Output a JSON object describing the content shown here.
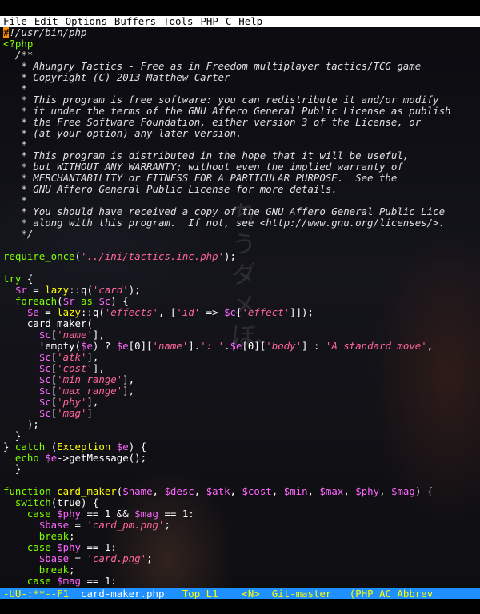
{
  "menu": [
    "File",
    "Edit",
    "Options",
    "Buffers",
    "Tools",
    "PHP",
    "C",
    "Help"
  ],
  "background_glyphs": "ちうダメぼ、",
  "code_lines": [
    [
      {
        "t": "#",
        "c": "cursor"
      },
      {
        "t": "!/usr/bin/php",
        "c": "cm"
      }
    ],
    [
      {
        "t": "<?php",
        "c": "kw"
      }
    ],
    [
      {
        "t": "  /**",
        "c": "cm"
      }
    ],
    [
      {
        "t": "   * Ahungry Tactics - Free as in Freedom multiplayer tactics/TCG game",
        "c": "cm"
      }
    ],
    [
      {
        "t": "   * Copyright (C) 2013 Matthew Carter",
        "c": "cm"
      }
    ],
    [
      {
        "t": "   *",
        "c": "cm"
      }
    ],
    [
      {
        "t": "   * This program is free software: you can redistribute it and/or modify",
        "c": "cm"
      }
    ],
    [
      {
        "t": "   * it under the terms of the GNU Affero General Public License as publish",
        "c": "cm"
      }
    ],
    [
      {
        "t": "   * the Free Software Foundation, either version 3 of the License, or",
        "c": "cm"
      }
    ],
    [
      {
        "t": "   * (at your option) any later version.",
        "c": "cm"
      }
    ],
    [
      {
        "t": "   *",
        "c": "cm"
      }
    ],
    [
      {
        "t": "   * This program is distributed in the hope that it will be useful,",
        "c": "cm"
      }
    ],
    [
      {
        "t": "   * but WITHOUT ANY WARRANTY; without even the implied warranty of",
        "c": "cm"
      }
    ],
    [
      {
        "t": "   * MERCHANTABILITY or FITNESS FOR A PARTICULAR PURPOSE.  See the",
        "c": "cm"
      }
    ],
    [
      {
        "t": "   * GNU Affero General Public License for more details.",
        "c": "cm"
      }
    ],
    [
      {
        "t": "   *",
        "c": "cm"
      }
    ],
    [
      {
        "t": "   * You should have received a copy of the GNU Affero General Public Lice",
        "c": "cm"
      }
    ],
    [
      {
        "t": "   * along with this program.  If not, see <http://www.gnu.org/licenses/>.",
        "c": "cm"
      }
    ],
    [
      {
        "t": "   */",
        "c": "cm"
      }
    ],
    [
      {
        "t": "",
        "c": ""
      }
    ],
    [
      {
        "t": "require_once",
        "c": "kw"
      },
      {
        "t": "(",
        "c": ""
      },
      {
        "t": "'../ini/tactics.inc.php'",
        "c": "str"
      },
      {
        "t": ");",
        "c": ""
      }
    ],
    [
      {
        "t": "",
        "c": ""
      }
    ],
    [
      {
        "t": "try",
        "c": "kw"
      },
      {
        "t": " {",
        "c": ""
      }
    ],
    [
      {
        "t": "  ",
        "c": ""
      },
      {
        "t": "$r",
        "c": "var"
      },
      {
        "t": " = ",
        "c": ""
      },
      {
        "t": "lazy",
        "c": "fn"
      },
      {
        "t": "::q(",
        "c": ""
      },
      {
        "t": "'card'",
        "c": "str"
      },
      {
        "t": ");",
        "c": ""
      }
    ],
    [
      {
        "t": "  ",
        "c": ""
      },
      {
        "t": "foreach",
        "c": "kw"
      },
      {
        "t": "(",
        "c": ""
      },
      {
        "t": "$r",
        "c": "var"
      },
      {
        "t": " as ",
        "c": "kw"
      },
      {
        "t": "$c",
        "c": "var"
      },
      {
        "t": ") {",
        "c": ""
      }
    ],
    [
      {
        "t": "    ",
        "c": ""
      },
      {
        "t": "$e",
        "c": "var"
      },
      {
        "t": " = ",
        "c": ""
      },
      {
        "t": "lazy",
        "c": "fn"
      },
      {
        "t": "::q(",
        "c": ""
      },
      {
        "t": "'effects'",
        "c": "str"
      },
      {
        "t": ", [",
        "c": ""
      },
      {
        "t": "'id'",
        "c": "str"
      },
      {
        "t": " => ",
        "c": ""
      },
      {
        "t": "$c",
        "c": "var"
      },
      {
        "t": "[",
        "c": ""
      },
      {
        "t": "'effect'",
        "c": "str"
      },
      {
        "t": "]]);",
        "c": ""
      }
    ],
    [
      {
        "t": "    card_maker(",
        "c": ""
      }
    ],
    [
      {
        "t": "      ",
        "c": ""
      },
      {
        "t": "$c",
        "c": "var"
      },
      {
        "t": "[",
        "c": ""
      },
      {
        "t": "'name'",
        "c": "str"
      },
      {
        "t": "],",
        "c": ""
      }
    ],
    [
      {
        "t": "      !empty(",
        "c": ""
      },
      {
        "t": "$e",
        "c": "var"
      },
      {
        "t": ") ? ",
        "c": ""
      },
      {
        "t": "$e",
        "c": "var"
      },
      {
        "t": "[0][",
        "c": ""
      },
      {
        "t": "'name'",
        "c": "str"
      },
      {
        "t": "].",
        "c": ""
      },
      {
        "t": "': '",
        "c": "str"
      },
      {
        "t": ".",
        "c": ""
      },
      {
        "t": "$e",
        "c": "var"
      },
      {
        "t": "[0][",
        "c": ""
      },
      {
        "t": "'body'",
        "c": "str"
      },
      {
        "t": "] : ",
        "c": ""
      },
      {
        "t": "'A standard move'",
        "c": "str"
      },
      {
        "t": ",",
        "c": ""
      }
    ],
    [
      {
        "t": "      ",
        "c": ""
      },
      {
        "t": "$c",
        "c": "var"
      },
      {
        "t": "[",
        "c": ""
      },
      {
        "t": "'atk'",
        "c": "str"
      },
      {
        "t": "],",
        "c": ""
      }
    ],
    [
      {
        "t": "      ",
        "c": ""
      },
      {
        "t": "$c",
        "c": "var"
      },
      {
        "t": "[",
        "c": ""
      },
      {
        "t": "'cost'",
        "c": "str"
      },
      {
        "t": "],",
        "c": ""
      }
    ],
    [
      {
        "t": "      ",
        "c": ""
      },
      {
        "t": "$c",
        "c": "var"
      },
      {
        "t": "[",
        "c": ""
      },
      {
        "t": "'min range'",
        "c": "str"
      },
      {
        "t": "],",
        "c": ""
      }
    ],
    [
      {
        "t": "      ",
        "c": ""
      },
      {
        "t": "$c",
        "c": "var"
      },
      {
        "t": "[",
        "c": ""
      },
      {
        "t": "'max range'",
        "c": "str"
      },
      {
        "t": "],",
        "c": ""
      }
    ],
    [
      {
        "t": "      ",
        "c": ""
      },
      {
        "t": "$c",
        "c": "var"
      },
      {
        "t": "[",
        "c": ""
      },
      {
        "t": "'phy'",
        "c": "str"
      },
      {
        "t": "],",
        "c": ""
      }
    ],
    [
      {
        "t": "      ",
        "c": ""
      },
      {
        "t": "$c",
        "c": "var"
      },
      {
        "t": "[",
        "c": ""
      },
      {
        "t": "'mag'",
        "c": "str"
      },
      {
        "t": "]",
        "c": ""
      }
    ],
    [
      {
        "t": "    );",
        "c": ""
      }
    ],
    [
      {
        "t": "  }",
        "c": ""
      }
    ],
    [
      {
        "t": "} ",
        "c": ""
      },
      {
        "t": "catch",
        "c": "kw"
      },
      {
        "t": " (",
        "c": ""
      },
      {
        "t": "Exception",
        "c": "fn"
      },
      {
        "t": " ",
        "c": ""
      },
      {
        "t": "$e",
        "c": "var"
      },
      {
        "t": ") {",
        "c": ""
      }
    ],
    [
      {
        "t": "  ",
        "c": ""
      },
      {
        "t": "echo",
        "c": "kw"
      },
      {
        "t": " ",
        "c": ""
      },
      {
        "t": "$e",
        "c": "var"
      },
      {
        "t": "->getMessage();",
        "c": ""
      }
    ],
    [
      {
        "t": "  }",
        "c": ""
      }
    ],
    [
      {
        "t": "",
        "c": ""
      }
    ],
    [
      {
        "t": "function",
        "c": "kw"
      },
      {
        "t": " ",
        "c": ""
      },
      {
        "t": "card_maker",
        "c": "fn"
      },
      {
        "t": "(",
        "c": ""
      },
      {
        "t": "$name",
        "c": "var"
      },
      {
        "t": ", ",
        "c": ""
      },
      {
        "t": "$desc",
        "c": "var"
      },
      {
        "t": ", ",
        "c": ""
      },
      {
        "t": "$atk",
        "c": "var"
      },
      {
        "t": ", ",
        "c": ""
      },
      {
        "t": "$cost",
        "c": "var"
      },
      {
        "t": ", ",
        "c": ""
      },
      {
        "t": "$min",
        "c": "var"
      },
      {
        "t": ", ",
        "c": ""
      },
      {
        "t": "$max",
        "c": "var"
      },
      {
        "t": ", ",
        "c": ""
      },
      {
        "t": "$phy",
        "c": "var"
      },
      {
        "t": ", ",
        "c": ""
      },
      {
        "t": "$mag",
        "c": "var"
      },
      {
        "t": ") {",
        "c": ""
      }
    ],
    [
      {
        "t": "  ",
        "c": ""
      },
      {
        "t": "switch",
        "c": "kw"
      },
      {
        "t": "(true) {",
        "c": ""
      }
    ],
    [
      {
        "t": "    ",
        "c": ""
      },
      {
        "t": "case",
        "c": "kw"
      },
      {
        "t": " ",
        "c": ""
      },
      {
        "t": "$phy",
        "c": "var"
      },
      {
        "t": " == 1 && ",
        "c": ""
      },
      {
        "t": "$mag",
        "c": "var"
      },
      {
        "t": " == 1:",
        "c": ""
      }
    ],
    [
      {
        "t": "      ",
        "c": ""
      },
      {
        "t": "$base",
        "c": "var"
      },
      {
        "t": " = ",
        "c": ""
      },
      {
        "t": "'card_pm.png'",
        "c": "str"
      },
      {
        "t": ";",
        "c": ""
      }
    ],
    [
      {
        "t": "      ",
        "c": ""
      },
      {
        "t": "break",
        "c": "kw"
      },
      {
        "t": ";",
        "c": ""
      }
    ],
    [
      {
        "t": "    ",
        "c": ""
      },
      {
        "t": "case",
        "c": "kw"
      },
      {
        "t": " ",
        "c": ""
      },
      {
        "t": "$phy",
        "c": "var"
      },
      {
        "t": " == 1:",
        "c": ""
      }
    ],
    [
      {
        "t": "      ",
        "c": ""
      },
      {
        "t": "$base",
        "c": "var"
      },
      {
        "t": " = ",
        "c": ""
      },
      {
        "t": "'card.png'",
        "c": "str"
      },
      {
        "t": ";",
        "c": ""
      }
    ],
    [
      {
        "t": "      ",
        "c": ""
      },
      {
        "t": "break",
        "c": "kw"
      },
      {
        "t": ";",
        "c": ""
      }
    ],
    [
      {
        "t": "    ",
        "c": ""
      },
      {
        "t": "case",
        "c": "kw"
      },
      {
        "t": " ",
        "c": ""
      },
      {
        "t": "$mag",
        "c": "var"
      },
      {
        "t": " == 1:",
        "c": ""
      }
    ]
  ],
  "modeline": {
    "status": "-UU-:**--F1",
    "buffer": "card-maker.php",
    "position": "Top L1",
    "narrow": "<N>",
    "vc": "Git-master",
    "modes": "(PHP AC Abbrev"
  }
}
